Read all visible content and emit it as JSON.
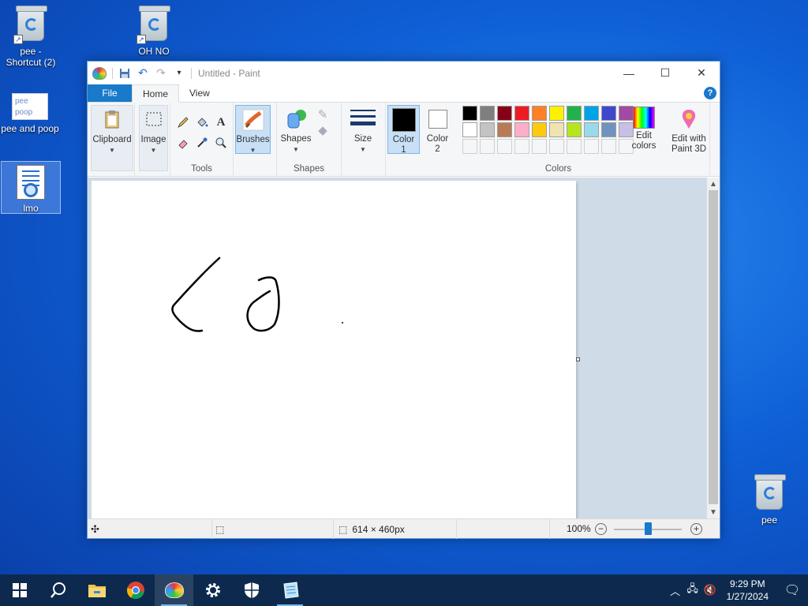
{
  "desktop": {
    "icons": [
      {
        "label": "pee -\nShortcut (2)"
      },
      {
        "label": "OH NO"
      },
      {
        "label": "pee and poop",
        "thumb_text": "pee poop"
      },
      {
        "label": "lmo"
      },
      {
        "label": "pee"
      }
    ]
  },
  "window": {
    "title": "Untitled - Paint",
    "tabs": [
      {
        "label": "File"
      },
      {
        "label": "Home"
      },
      {
        "label": "View"
      }
    ],
    "help": "?",
    "groups": {
      "clipboard": {
        "label": "Clipboard"
      },
      "image": {
        "label": "Image"
      },
      "tools": {
        "label": "Tools"
      },
      "brushes": {
        "label": "Brushes"
      },
      "shapes": {
        "label": "Shapes",
        "button": "Shapes"
      },
      "size": {
        "label": "Size"
      },
      "color1": {
        "label": "Color\n1",
        "color": "#000000"
      },
      "color2": {
        "label": "Color\n2",
        "color": "#ffffff"
      },
      "colors": {
        "label": "Colors"
      },
      "edit_colors": {
        "label": "Edit\ncolors"
      },
      "paint3d": {
        "label": "Edit with\nPaint 3D"
      }
    },
    "palette_row1": [
      "#000000",
      "#7f7f7f",
      "#880015",
      "#ed1c24",
      "#ff7f27",
      "#fff200",
      "#22b14c",
      "#00a2e8",
      "#3f48cc",
      "#a349a4"
    ],
    "palette_row2": [
      "#ffffff",
      "#c3c3c3",
      "#b97a57",
      "#ffaec9",
      "#ffc90e",
      "#efe4b0",
      "#b5e61d",
      "#99d9ea",
      "#7092be",
      "#c8bfe7"
    ],
    "status": {
      "dimensions": "614 × 460px",
      "zoom": "100%"
    }
  },
  "taskbar": {
    "time": "9:29 PM",
    "date": "1/27/2024"
  }
}
